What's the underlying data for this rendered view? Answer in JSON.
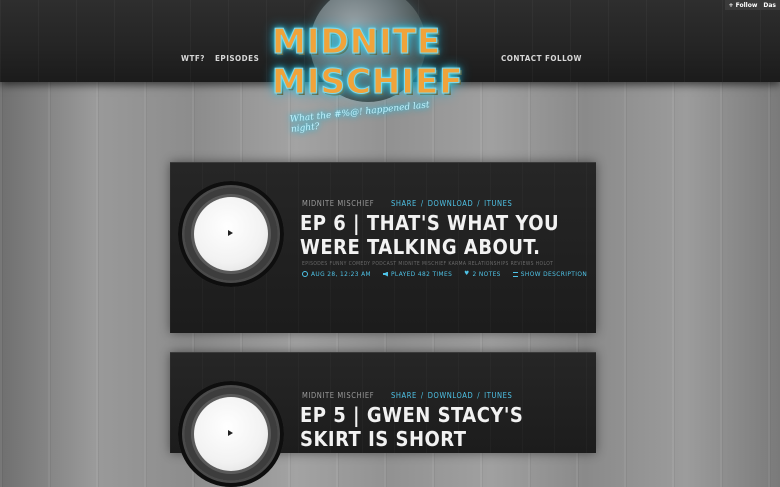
{
  "colors": {
    "accent": "#4fc4e8",
    "logo_orange": "#f0a33a",
    "card_bg": "#212121"
  },
  "follow_widget": {
    "follow_label": "+ Follow",
    "dash_label": "Das"
  },
  "nav": {
    "left": [
      "WTF?",
      "EPISODES"
    ],
    "right": [
      "CONTACT",
      "FOLLOW"
    ]
  },
  "logo": {
    "line1": "MIDNITE",
    "line2": "MISCHIEF",
    "tagline": "What the #%@! happened last night?"
  },
  "posts": [
    {
      "show": "MIDNITE MISCHIEF",
      "links": [
        "SHARE",
        "DOWNLOAD",
        "ITUNES"
      ],
      "title": "EP 6 | THAT'S WHAT YOU WERE TALKING ABOUT.",
      "tags": "EPISODES  FUNNY  COMEDY  PODCAST  MIDNITE MISCHIEF  KARMA  RELATIONSHIPS  REVIEWS  HOLOT",
      "date": "AUG 28, 12:23 AM",
      "played": "PLAYED 482 TIMES",
      "notes": "2 NOTES",
      "show_description": "SHOW DESCRIPTION"
    },
    {
      "show": "MIDNITE MISCHIEF",
      "links": [
        "SHARE",
        "DOWNLOAD",
        "ITUNES"
      ],
      "title": "EP 5 | GWEN STACY'S SKIRT IS SHORT"
    }
  ]
}
